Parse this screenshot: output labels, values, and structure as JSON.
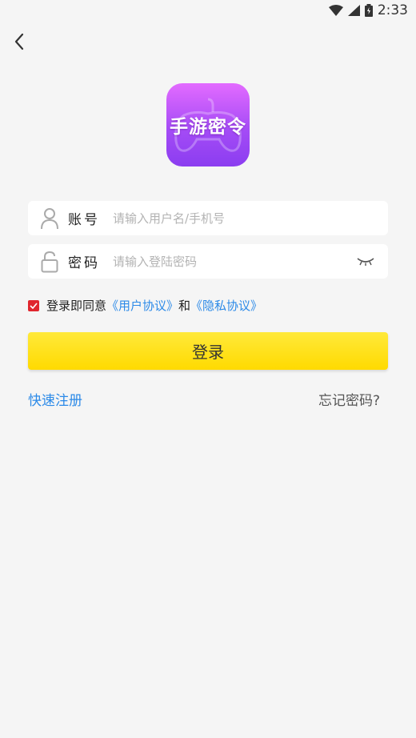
{
  "status_bar": {
    "time": "2:33"
  },
  "app": {
    "logo_text": "手游密令"
  },
  "form": {
    "account": {
      "label": "账号",
      "placeholder": "请输入用户名/手机号"
    },
    "password": {
      "label": "密码",
      "placeholder": "请输入登陆密码"
    }
  },
  "agreement": {
    "checked": true,
    "prefix": "登录即同意",
    "user_agreement": "《用户协议》",
    "and": "和",
    "privacy_policy": "《隐私协议》"
  },
  "buttons": {
    "login": "登录",
    "register": "快速注册",
    "forgot": "忘记密码?"
  },
  "colors": {
    "background": "#f5f5f5",
    "accent_yellow": "#ffda00",
    "link_blue": "#2c8ae8",
    "checkbox_red": "#e0262e",
    "logo_purple": "#a54cf6"
  },
  "icons": {
    "back": "back-arrow-icon",
    "user": "user-icon",
    "lock": "lock-icon",
    "eye": "eye-closed-icon",
    "wifi": "wifi-icon",
    "signal": "signal-icon",
    "battery": "battery-icon"
  }
}
